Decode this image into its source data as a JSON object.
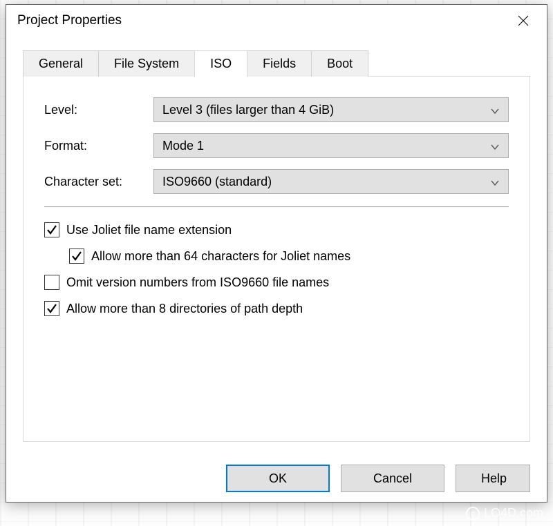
{
  "dialog": {
    "title": "Project Properties"
  },
  "tabs": {
    "items": [
      {
        "label": "General",
        "active": false
      },
      {
        "label": "File System",
        "active": false
      },
      {
        "label": "ISO",
        "active": true
      },
      {
        "label": "Fields",
        "active": false
      },
      {
        "label": "Boot",
        "active": false
      }
    ]
  },
  "iso": {
    "level_label": "Level:",
    "level_value": "Level 3 (files larger than 4 GiB)",
    "format_label": "Format:",
    "format_value": "Mode 1",
    "charset_label": "Character set:",
    "charset_value": "ISO9660 (standard)",
    "check_joliet": {
      "label": "Use Joliet file name extension",
      "checked": true
    },
    "check_joliet64": {
      "label": "Allow more than 64 characters for Joliet names",
      "checked": true
    },
    "check_omit": {
      "label": "Omit version numbers from ISO9660 file names",
      "checked": false
    },
    "check_depth": {
      "label": "Allow more than 8 directories of path depth",
      "checked": true
    }
  },
  "buttons": {
    "ok": "OK",
    "cancel": "Cancel",
    "help": "Help"
  },
  "watermark": "LO4D.com"
}
